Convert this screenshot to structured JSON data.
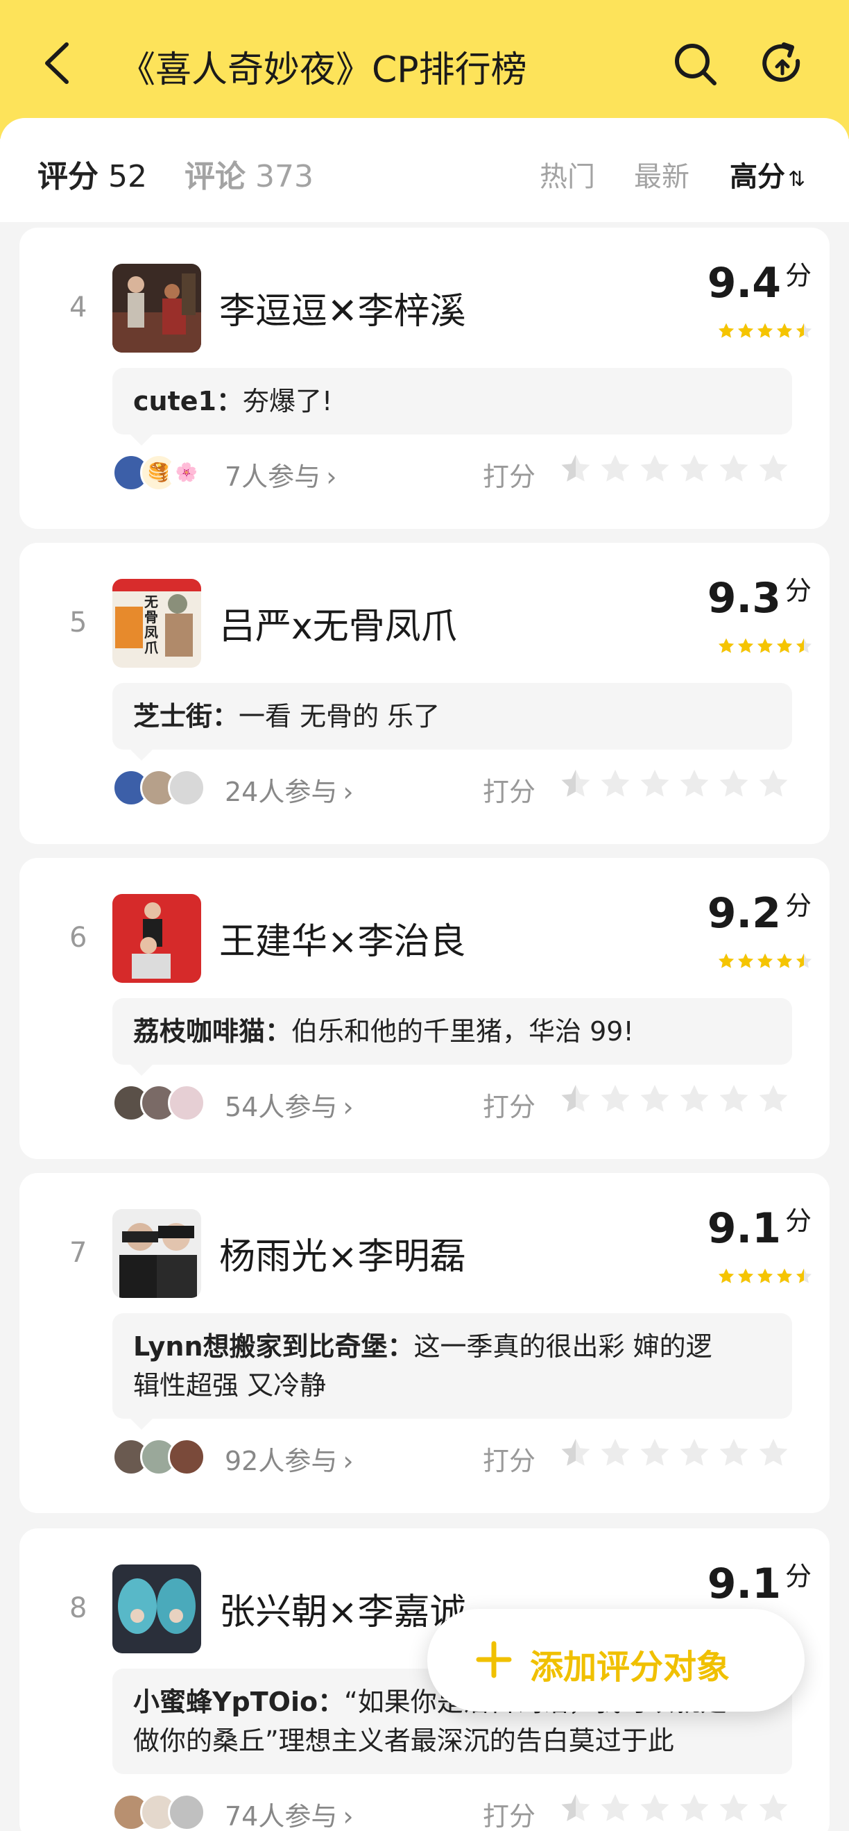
{
  "header": {
    "title": "《喜人奇妙夜》CP排行榜",
    "back_icon": "chevron-left-icon",
    "search_icon": "search-icon",
    "refresh_icon": "refresh-icon",
    "bg_color": "#fde35a"
  },
  "tabs": [
    {
      "label": "评分",
      "count": "52",
      "active": true
    },
    {
      "label": "评论",
      "count": "373",
      "active": false
    }
  ],
  "sort": {
    "hot": "热门",
    "new": "最新",
    "high": "高分",
    "active": "high",
    "sort_icon": "sort-icon"
  },
  "items": [
    {
      "rank": "4",
      "name_left": "李逗逗",
      "name_sep": "✕",
      "name_right": "李梓溪",
      "score": "9.4",
      "score_unit": "分",
      "comment_user": "cute1：",
      "comment_text": "夯爆了!",
      "participants": "7人参与",
      "rate_label": "打分"
    },
    {
      "rank": "5",
      "name": "吕严x无骨凤爪",
      "score": "9.3",
      "score_unit": "分",
      "comment_user": "芝士街：",
      "comment_text": "一看 无骨的 乐了",
      "participants": "24人参与",
      "rate_label": "打分",
      "cover_text": "无骨凤爪"
    },
    {
      "rank": "6",
      "name": "王建华×李治良",
      "score": "9.2",
      "score_unit": "分",
      "comment_user": "荔枝咖啡猫：",
      "comment_text": "伯乐和他的千里猪，华治 99!",
      "participants": "54人参与",
      "rate_label": "打分"
    },
    {
      "rank": "7",
      "name": "杨雨光×李明磊",
      "score": "9.1",
      "score_unit": "分",
      "comment_user": "Lynn想搬家到比奇堡：",
      "comment_line1_rest": "这一季真的很出彩 婶的逻",
      "comment_line2": "辑性超强 又冷静",
      "participants": "92人参与",
      "rate_label": "打分"
    },
    {
      "rank": "8",
      "name": "张兴朝×李嘉诚",
      "score": "9.1",
      "score_unit": "分",
      "comment_user": "小蜜蜂YpTOio：",
      "comment_line1_rest": "“如果你是潜台词话，我可以就是",
      "comment_line2": "做你的桑丘”理想主义者最深沉的告白莫过于此",
      "participants": "74人参与",
      "rate_label": "打分"
    }
  ],
  "fab": {
    "label": "添加评分对象",
    "icon": "plus-icon",
    "color": "#f0c000"
  },
  "colors": {
    "star_filled": "#f5c400",
    "star_empty": "#e6e6e6",
    "page_bg": "#f4f4f4"
  }
}
